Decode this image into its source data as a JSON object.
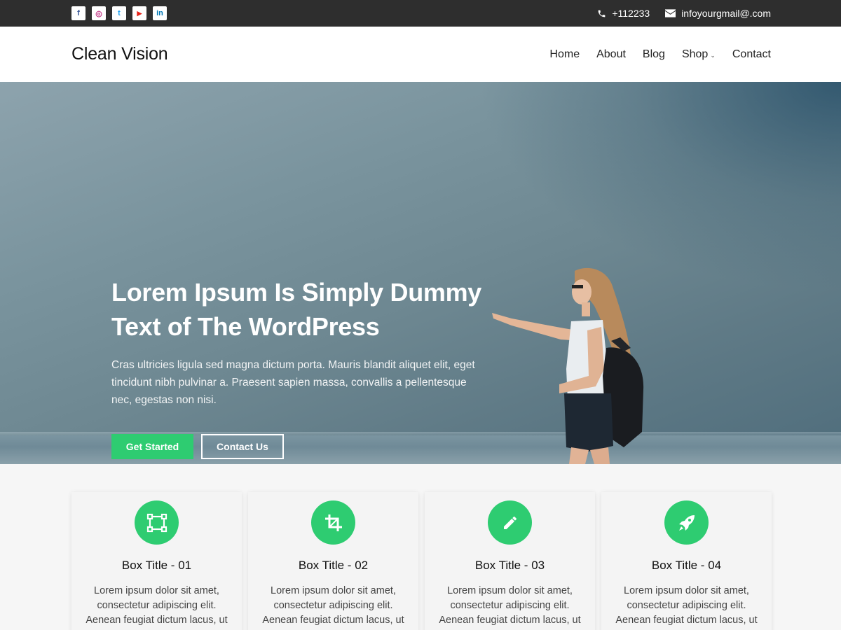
{
  "topbar": {
    "social": [
      {
        "icon": "facebook-icon",
        "glyph": "f",
        "color": "#3b5998"
      },
      {
        "icon": "instagram-icon",
        "glyph": "◎",
        "color": "#c13584"
      },
      {
        "icon": "twitter-icon",
        "glyph": "t",
        "color": "#1da1f2"
      },
      {
        "icon": "youtube-icon",
        "glyph": "▶",
        "color": "#e62117"
      },
      {
        "icon": "linkedin-icon",
        "glyph": "in",
        "color": "#0077b5"
      }
    ],
    "phone": "+112233",
    "email": "infoyourgmail@.com"
  },
  "header": {
    "logo": "Clean Vision",
    "nav": [
      {
        "label": "Home"
      },
      {
        "label": "About"
      },
      {
        "label": "Blog"
      },
      {
        "label": "Shop",
        "has_dropdown": true
      },
      {
        "label": "Contact"
      }
    ]
  },
  "hero": {
    "title_line1": "Lorem Ipsum Is Simply Dummy",
    "title_line2": "Text of The WordPress",
    "text": "Cras ultricies ligula sed magna dictum porta. Mauris blandit aliquet elit, eget tincidunt nibh pulvinar a. Praesent sapien massa, convallis a pellentesque nec, egestas non nisi.",
    "primary_button": "Get Started",
    "secondary_button": "Contact Us"
  },
  "features": [
    {
      "icon": "crop-select-icon",
      "title": "Box Title - 01",
      "text": "Lorem ipsum dolor sit amet, consectetur adipiscing elit. Aenean feugiat dictum lacus, ut hendrerit"
    },
    {
      "icon": "crop-icon",
      "title": "Box Title - 02",
      "text": "Lorem ipsum dolor sit amet, consectetur adipiscing elit. Aenean feugiat dictum lacus, ut hendrerit"
    },
    {
      "icon": "pencil-icon",
      "title": "Box Title - 03",
      "text": "Lorem ipsum dolor sit amet, consectetur adipiscing elit. Aenean feugiat dictum lacus, ut hendrerit"
    },
    {
      "icon": "rocket-icon",
      "title": "Box Title - 04",
      "text": "Lorem ipsum dolor sit amet, consectetur adipiscing elit. Aenean feugiat dictum lacus, ut hendrerit"
    }
  ],
  "colors": {
    "accent": "#2ecc71",
    "topbar": "#2e2e2e"
  }
}
